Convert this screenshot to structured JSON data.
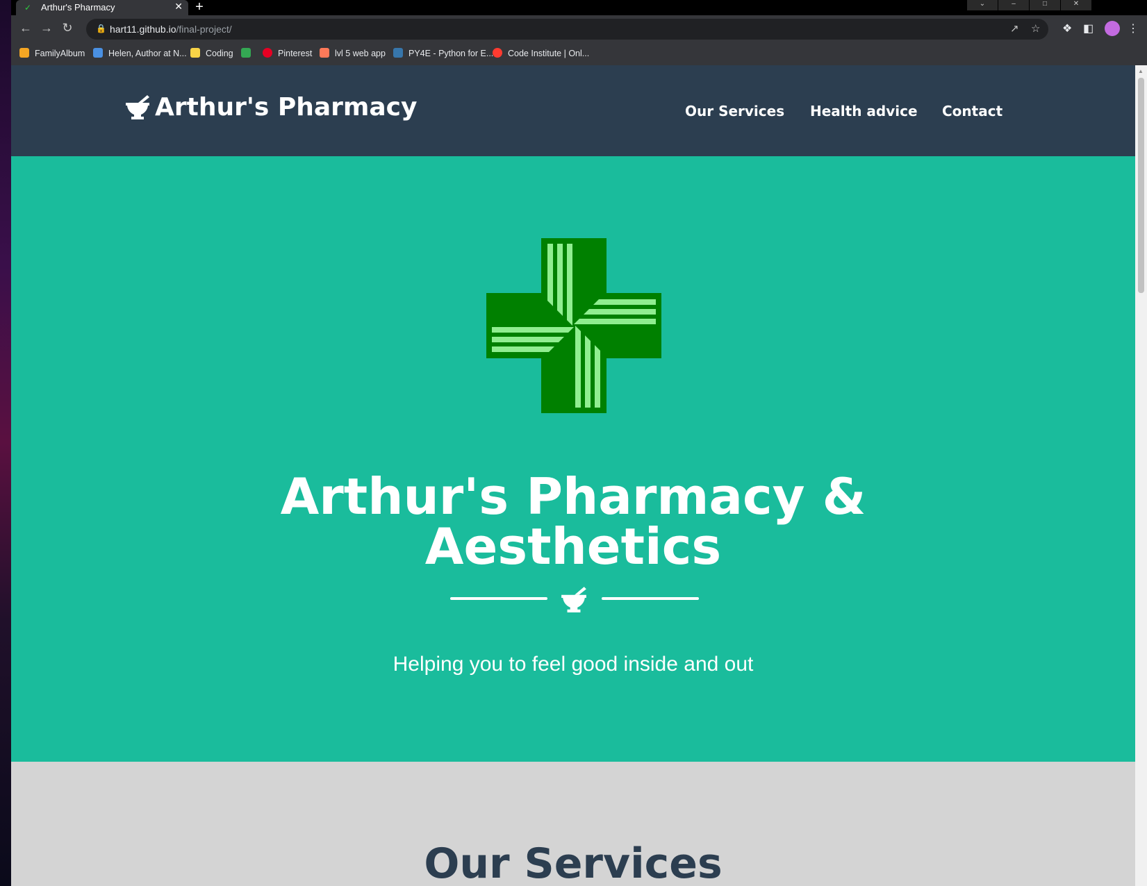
{
  "browser": {
    "tab_title": "Arthur's Pharmacy",
    "tab_close": "✕",
    "new_tab": "+",
    "url_host": "hart11.github.io",
    "url_path": "/final-project/",
    "bookmarks": [
      {
        "label": "FamilyAlbum",
        "color": "#f5a623"
      },
      {
        "label": "Helen, Author at N...",
        "color": "#4a90e2"
      },
      {
        "label": "Coding",
        "color": "#f8d347"
      },
      {
        "label": "",
        "color": "#34a853"
      },
      {
        "label": "Pinterest",
        "color": "#e60023"
      },
      {
        "label": "lvl 5 web app",
        "color": "#ff7a59"
      },
      {
        "label": "PY4E - Python for E...",
        "color": "#3776ab"
      },
      {
        "label": "Code Institute | Onl...",
        "color": "#ff3b30"
      }
    ]
  },
  "site": {
    "brand": "Arthur's Pharmacy",
    "nav": [
      "Our Services",
      "Health advice",
      "Contact"
    ],
    "hero_title_line1": "Arthur's Pharmacy &",
    "hero_title_line2": "Aesthetics",
    "hero_subtitle": "Helping you to feel good inside and out",
    "services_title": "Our Services"
  },
  "colors": {
    "nav_bg": "#2c3e50",
    "hero_bg": "#1abc9c",
    "cross_green": "#008000",
    "cross_stripe": "#90ee90",
    "services_bg": "#d4d4d4"
  }
}
